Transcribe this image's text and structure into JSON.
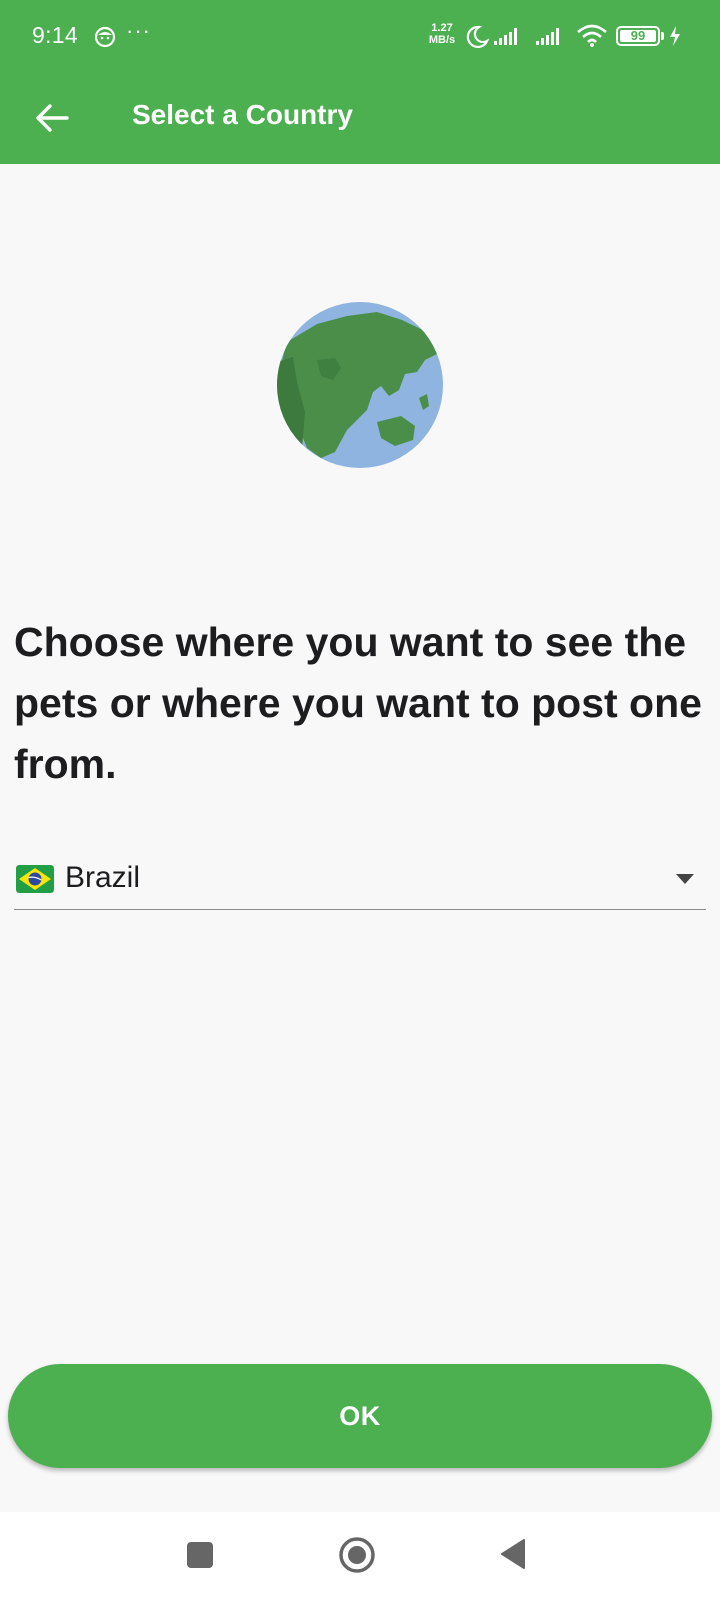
{
  "status_bar": {
    "time": "9:14",
    "more": "···",
    "net_speed_value": "1.27",
    "net_speed_unit": "MB/s",
    "battery_level": "99",
    "battery_fraction": 0.99
  },
  "app_bar": {
    "title": "Select a Country",
    "back_icon": "arrow-back-icon",
    "background": "#4caf50"
  },
  "main": {
    "illustration_icon": "globe-icon",
    "headline": "Choose where you want to see the pets or where you want to post one from.",
    "country_select": {
      "selected_value": "Brazil",
      "flag_icon": "brazil-flag-icon",
      "dropdown_icon": "chevron-down-icon"
    },
    "ok_button_label": "OK"
  },
  "nav_bar": {
    "recents_icon": "square-icon",
    "home_icon": "circle-icon",
    "back_icon": "triangle-back-icon"
  },
  "colors": {
    "accent": "#4caf50",
    "background": "#f8f8f9",
    "text": "#1d1d1f"
  }
}
